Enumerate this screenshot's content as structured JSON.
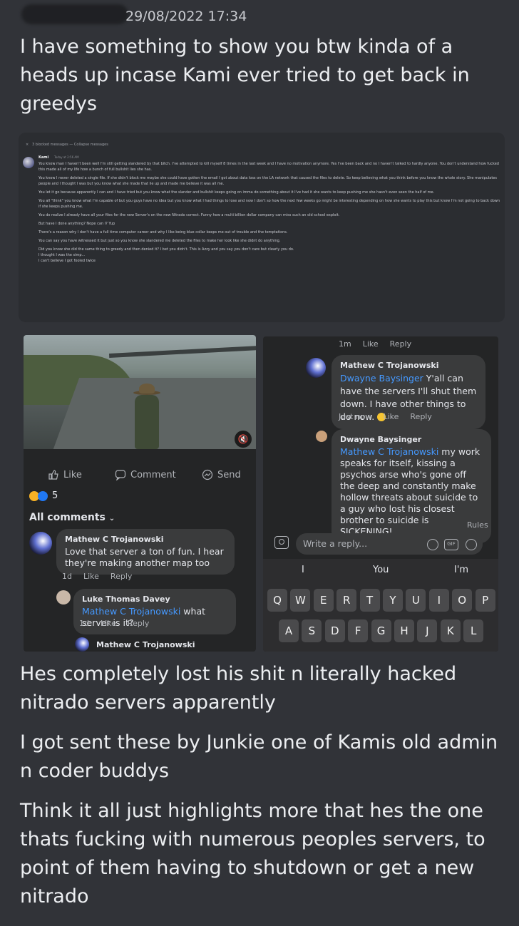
{
  "header": {
    "timestamp": "29/08/2022 17:34"
  },
  "messages": {
    "m1": "I have something to show you btw kinda of a heads up incase Kami ever tried to get back in greedys",
    "m2": "Hes completely lost his shit n literally hacked nitrado servers apparently",
    "m3": "I got sent these by Junkie one of Kamis old admin n coder buddys",
    "m4": "Think it all just highlights more that hes the one thats fucking with numerous peoples servers, to point of them having to shutdown or get a new nitrado"
  },
  "discord_shot": {
    "blocked_label": "3 blocked messages — Collapse messages",
    "close": "×",
    "username": "Kami",
    "time": "Today at 2:56 AM",
    "lines": [
      "You know man I haven't been well I'm still getting slandered by that bitch. I've attempted to kill myself 8 times in the last week and I have no motivation anymore. Yes I've been back and no I haven't talked to hardly anyone. You don't understand how fucked this made all of my life how a bunch of full bullshit lies she has.",
      "You know I never deleted a single file. If she didn't block me maybe she could have gotten the email I got about data loss on the LA network that caused the files to delete. So keep believing what you think before you know the whole story. She manipulates people and I thought I was but you know what she made that lie up and made me believe it was all me.",
      "You let it go because apparently I can and I have tried but you know what the slander and bullshit keeps going on imma do something about it I've had it she wants to keep pushing me she hasn't even seen the half of me.",
      "You all \"think\" you know what I'm capable of but you guys have no idea but you know what I had things to lose and now I don't so how the next few weeks go might be interesting depending on how she wants to play this but know I'm not going to back down if she keeps pushing me.",
      "You do realize I already have all your files for the new Server's on the new Nitrado correct. Funny how a multi billion dollar company can miss such an old school exploit.",
      "But have I done anything? Nope can I? Yup",
      "There's a reason why I don't have a full time computer career and why I like being blue collar keeps me out of trouble and the temptations.",
      "You can say you have witnessed it but just so you know she slandered me deleted the files to make her look like she didnt do anything.",
      "Did you know she did the same thing to greedy and then denied it? I bet you didn't. This is Azzy and you say you don't care but clearly you do.",
      "I thought I was the simp...",
      "I can't believe I got fooled twice"
    ]
  },
  "fb_left": {
    "actions": {
      "like": "Like",
      "comment": "Comment",
      "send": "Send"
    },
    "reaction_count": "5",
    "all_comments": "All comments",
    "comments": [
      {
        "name": "Mathew C Trojanowski",
        "text": "Love that server a ton of fun. I hear they're making another map too",
        "time": "1d",
        "like": "Like",
        "reply": "Reply"
      },
      {
        "name": "Luke Thomas Davey",
        "mention": "Mathew C Trojanowski",
        "text": " what server is it?",
        "time": "1d",
        "like": "Like",
        "reply": "Reply"
      },
      {
        "name": "Mathew C Trojanowski"
      }
    ]
  },
  "fb_right": {
    "top_meta": {
      "time": "1m",
      "like": "Like",
      "reply": "Reply"
    },
    "replies": [
      {
        "name": "Mathew C Trojanowski",
        "mention": "Dwayne Baysinger",
        "text": " Y'all can have the servers I'll shut them down. I have other things to do now.",
        "time": "Just now",
        "like": "Like",
        "reply": "Reply"
      },
      {
        "name": "Dwayne Baysinger",
        "mention": "Mathew C Trojanowski",
        "text": " my work speaks for itself, kissing a psychos arse who's gone off the deep and constantly make hollow threats about suicide to a guy who lost his closest brother to suicide is SICKENING!"
      }
    ],
    "rules": "Rules",
    "reply_placeholder": "Write a reply...",
    "suggestions": [
      "I",
      "You",
      "I'm"
    ],
    "keys_row1": [
      "Q",
      "W",
      "E",
      "R",
      "T",
      "Y",
      "U",
      "I",
      "O",
      "P"
    ],
    "keys_row2": [
      "A",
      "S",
      "D",
      "F",
      "G",
      "H",
      "J",
      "K",
      "L"
    ]
  }
}
